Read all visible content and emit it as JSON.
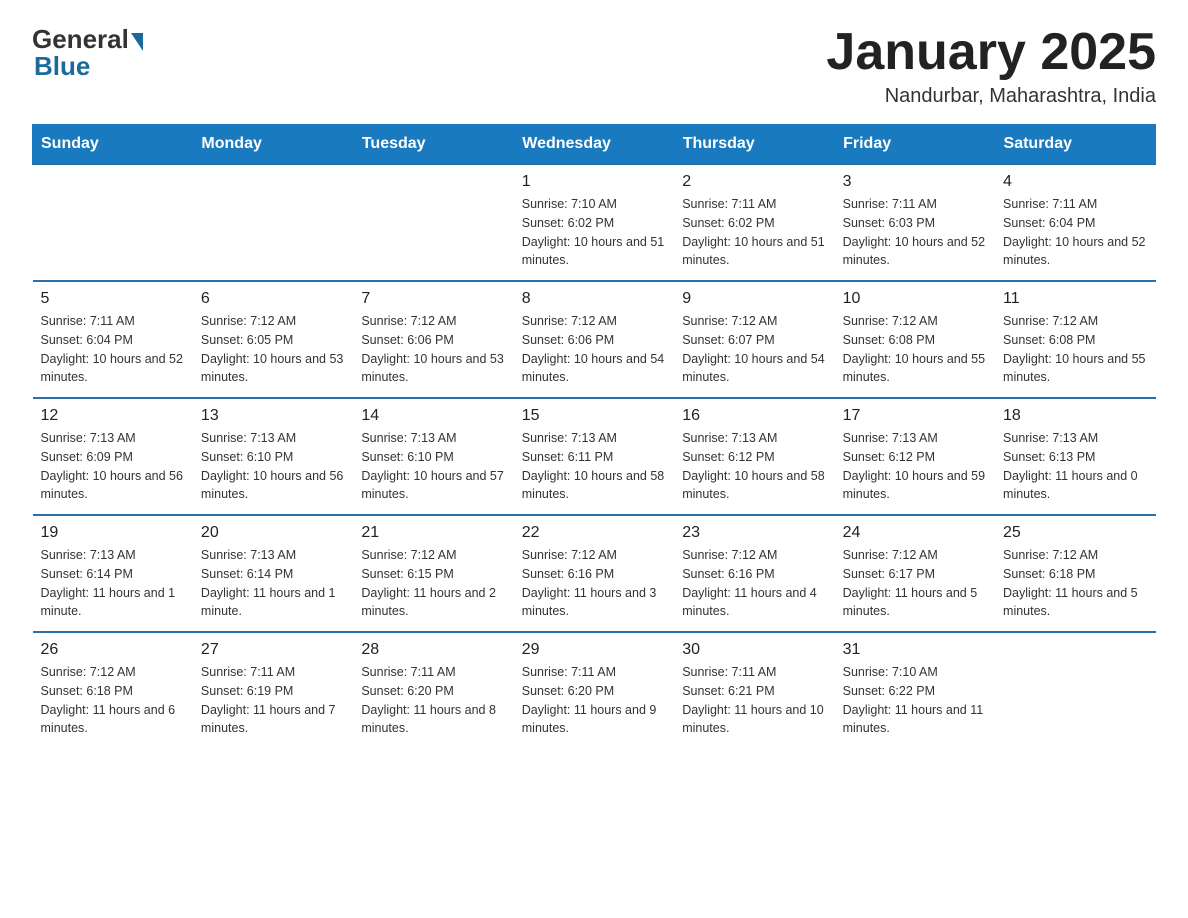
{
  "logo": {
    "general": "General",
    "blue": "Blue"
  },
  "title": "January 2025",
  "location": "Nandurbar, Maharashtra, India",
  "weekdays": [
    "Sunday",
    "Monday",
    "Tuesday",
    "Wednesday",
    "Thursday",
    "Friday",
    "Saturday"
  ],
  "weeks": [
    [
      {
        "day": "",
        "info": ""
      },
      {
        "day": "",
        "info": ""
      },
      {
        "day": "",
        "info": ""
      },
      {
        "day": "1",
        "info": "Sunrise: 7:10 AM\nSunset: 6:02 PM\nDaylight: 10 hours and 51 minutes."
      },
      {
        "day": "2",
        "info": "Sunrise: 7:11 AM\nSunset: 6:02 PM\nDaylight: 10 hours and 51 minutes."
      },
      {
        "day": "3",
        "info": "Sunrise: 7:11 AM\nSunset: 6:03 PM\nDaylight: 10 hours and 52 minutes."
      },
      {
        "day": "4",
        "info": "Sunrise: 7:11 AM\nSunset: 6:04 PM\nDaylight: 10 hours and 52 minutes."
      }
    ],
    [
      {
        "day": "5",
        "info": "Sunrise: 7:11 AM\nSunset: 6:04 PM\nDaylight: 10 hours and 52 minutes."
      },
      {
        "day": "6",
        "info": "Sunrise: 7:12 AM\nSunset: 6:05 PM\nDaylight: 10 hours and 53 minutes."
      },
      {
        "day": "7",
        "info": "Sunrise: 7:12 AM\nSunset: 6:06 PM\nDaylight: 10 hours and 53 minutes."
      },
      {
        "day": "8",
        "info": "Sunrise: 7:12 AM\nSunset: 6:06 PM\nDaylight: 10 hours and 54 minutes."
      },
      {
        "day": "9",
        "info": "Sunrise: 7:12 AM\nSunset: 6:07 PM\nDaylight: 10 hours and 54 minutes."
      },
      {
        "day": "10",
        "info": "Sunrise: 7:12 AM\nSunset: 6:08 PM\nDaylight: 10 hours and 55 minutes."
      },
      {
        "day": "11",
        "info": "Sunrise: 7:12 AM\nSunset: 6:08 PM\nDaylight: 10 hours and 55 minutes."
      }
    ],
    [
      {
        "day": "12",
        "info": "Sunrise: 7:13 AM\nSunset: 6:09 PM\nDaylight: 10 hours and 56 minutes."
      },
      {
        "day": "13",
        "info": "Sunrise: 7:13 AM\nSunset: 6:10 PM\nDaylight: 10 hours and 56 minutes."
      },
      {
        "day": "14",
        "info": "Sunrise: 7:13 AM\nSunset: 6:10 PM\nDaylight: 10 hours and 57 minutes."
      },
      {
        "day": "15",
        "info": "Sunrise: 7:13 AM\nSunset: 6:11 PM\nDaylight: 10 hours and 58 minutes."
      },
      {
        "day": "16",
        "info": "Sunrise: 7:13 AM\nSunset: 6:12 PM\nDaylight: 10 hours and 58 minutes."
      },
      {
        "day": "17",
        "info": "Sunrise: 7:13 AM\nSunset: 6:12 PM\nDaylight: 10 hours and 59 minutes."
      },
      {
        "day": "18",
        "info": "Sunrise: 7:13 AM\nSunset: 6:13 PM\nDaylight: 11 hours and 0 minutes."
      }
    ],
    [
      {
        "day": "19",
        "info": "Sunrise: 7:13 AM\nSunset: 6:14 PM\nDaylight: 11 hours and 1 minute."
      },
      {
        "day": "20",
        "info": "Sunrise: 7:13 AM\nSunset: 6:14 PM\nDaylight: 11 hours and 1 minute."
      },
      {
        "day": "21",
        "info": "Sunrise: 7:12 AM\nSunset: 6:15 PM\nDaylight: 11 hours and 2 minutes."
      },
      {
        "day": "22",
        "info": "Sunrise: 7:12 AM\nSunset: 6:16 PM\nDaylight: 11 hours and 3 minutes."
      },
      {
        "day": "23",
        "info": "Sunrise: 7:12 AM\nSunset: 6:16 PM\nDaylight: 11 hours and 4 minutes."
      },
      {
        "day": "24",
        "info": "Sunrise: 7:12 AM\nSunset: 6:17 PM\nDaylight: 11 hours and 5 minutes."
      },
      {
        "day": "25",
        "info": "Sunrise: 7:12 AM\nSunset: 6:18 PM\nDaylight: 11 hours and 5 minutes."
      }
    ],
    [
      {
        "day": "26",
        "info": "Sunrise: 7:12 AM\nSunset: 6:18 PM\nDaylight: 11 hours and 6 minutes."
      },
      {
        "day": "27",
        "info": "Sunrise: 7:11 AM\nSunset: 6:19 PM\nDaylight: 11 hours and 7 minutes."
      },
      {
        "day": "28",
        "info": "Sunrise: 7:11 AM\nSunset: 6:20 PM\nDaylight: 11 hours and 8 minutes."
      },
      {
        "day": "29",
        "info": "Sunrise: 7:11 AM\nSunset: 6:20 PM\nDaylight: 11 hours and 9 minutes."
      },
      {
        "day": "30",
        "info": "Sunrise: 7:11 AM\nSunset: 6:21 PM\nDaylight: 11 hours and 10 minutes."
      },
      {
        "day": "31",
        "info": "Sunrise: 7:10 AM\nSunset: 6:22 PM\nDaylight: 11 hours and 11 minutes."
      },
      {
        "day": "",
        "info": ""
      }
    ]
  ]
}
